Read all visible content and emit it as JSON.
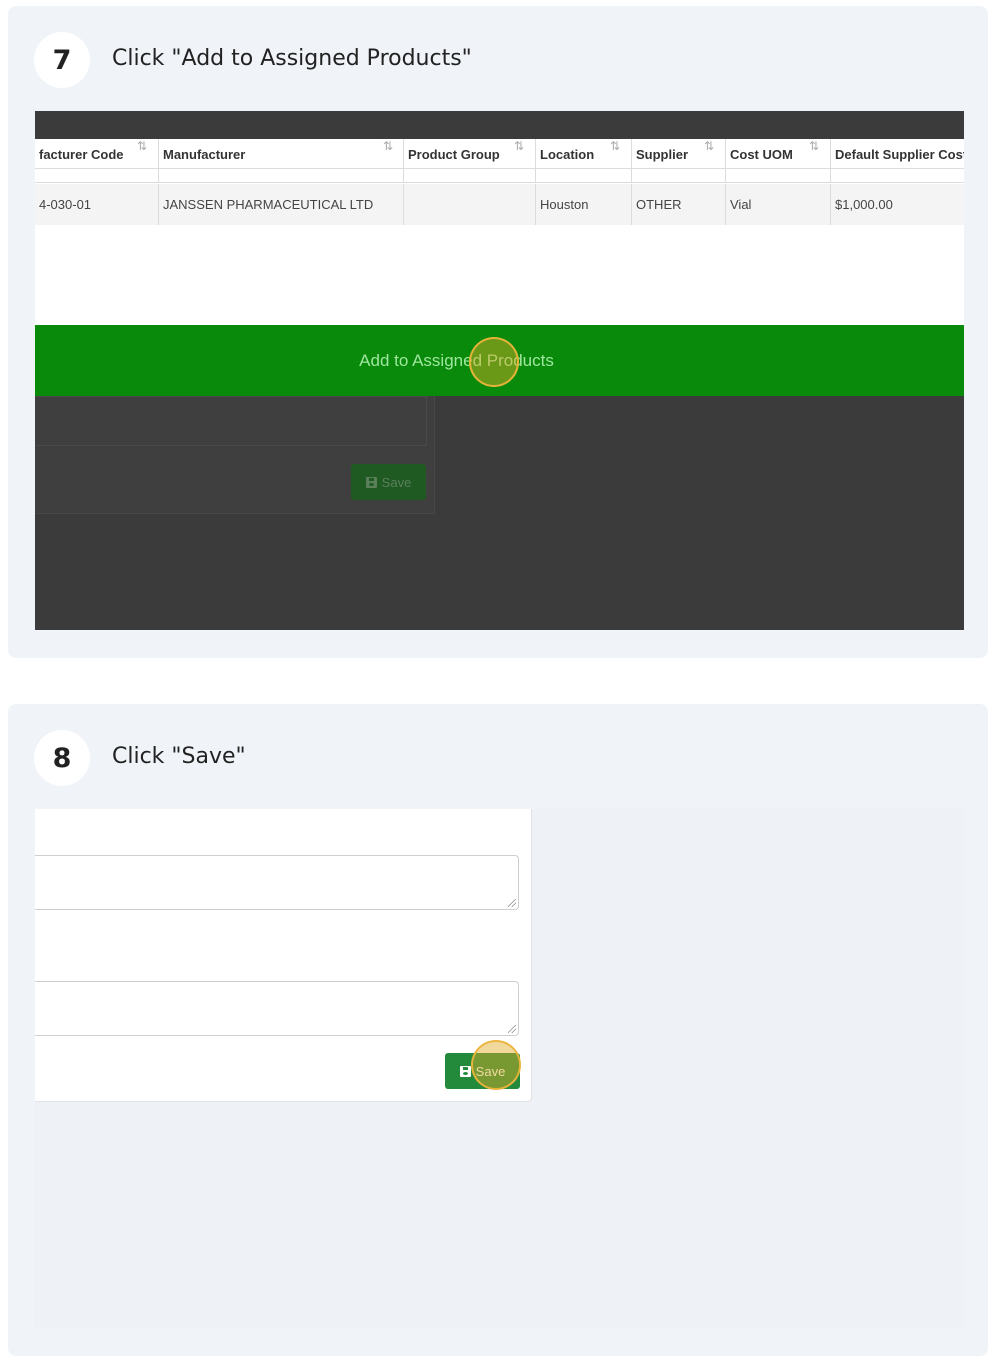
{
  "steps": [
    {
      "number": "7",
      "title": "Click \"Add to Assigned Products\"",
      "table": {
        "headers": [
          "facturer Code",
          "Manufacturer",
          "Product Group",
          "Location",
          "Supplier",
          "Cost UOM",
          "Default Supplier Cost"
        ],
        "row": [
          "4-030-01",
          "JANSSEN PHARMACEUTICAL LTD",
          "",
          "Houston",
          "OTHER",
          "Vial",
          "$1,000.00"
        ]
      },
      "action_button": "Add to Assigned Products",
      "background_save": "Save"
    },
    {
      "number": "8",
      "title": "Click \"Save\"",
      "save_button": "Save"
    }
  ],
  "colors": {
    "card_bg": "#f0f3f8",
    "add_button_bg": "#0a8a0a",
    "save_button_bg": "#238a3b",
    "overlay_bg": "#3b3b3b",
    "highlight": "#e1aa28"
  }
}
